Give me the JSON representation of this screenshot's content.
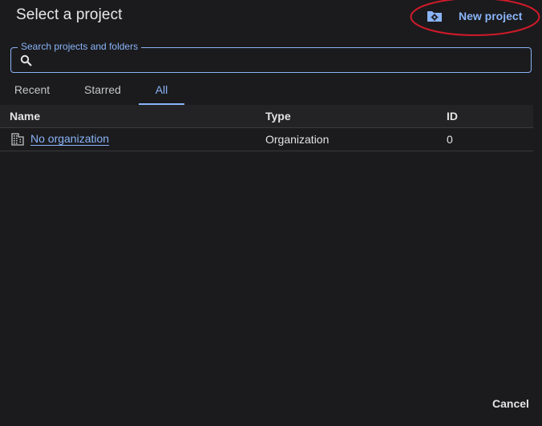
{
  "dialog": {
    "title": "Select a project",
    "new_project_label": "New project",
    "cancel_label": "Cancel"
  },
  "search": {
    "label": "Search projects and folders",
    "value": "",
    "placeholder": ""
  },
  "tabs": [
    {
      "label": "Recent",
      "active": false
    },
    {
      "label": "Starred",
      "active": false
    },
    {
      "label": "All",
      "active": true
    }
  ],
  "table": {
    "headers": {
      "name": "Name",
      "type": "Type",
      "id": "ID"
    },
    "rows": [
      {
        "name": "No organization",
        "type": "Organization",
        "id": "0",
        "icon": "building-icon"
      }
    ]
  },
  "colors": {
    "background": "#1b1b1d",
    "accent": "#8ab4f8",
    "annotation": "#d11a2a"
  }
}
